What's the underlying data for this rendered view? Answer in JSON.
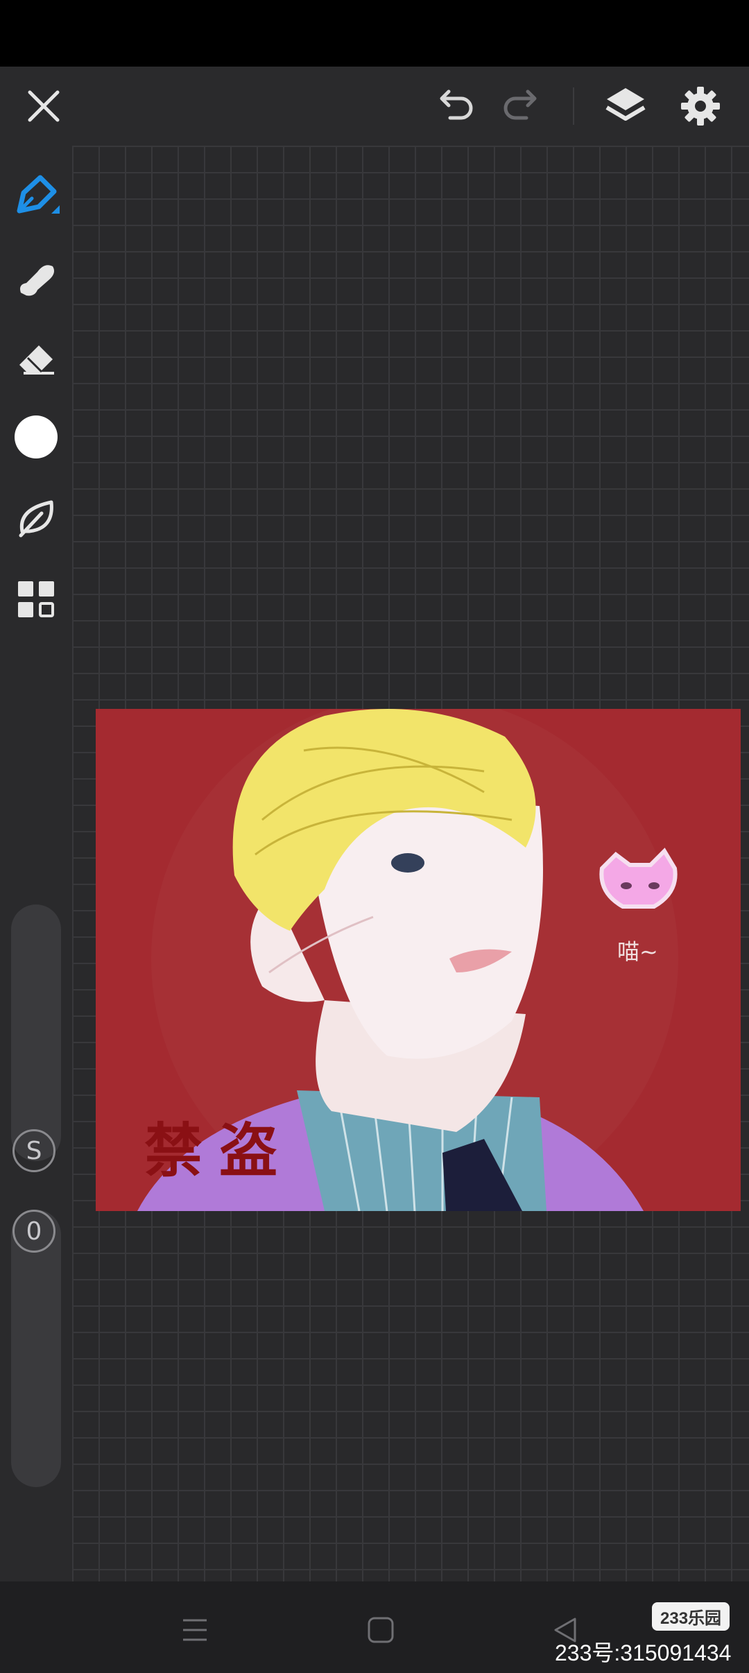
{
  "topbar": {
    "close_icon": "close-icon",
    "undo_icon": "undo-icon",
    "redo_icon": "redo-icon",
    "layers_icon": "layers-icon",
    "settings_icon": "gear-icon"
  },
  "tools": [
    {
      "name": "pen",
      "icon": "pen-icon",
      "selected": true
    },
    {
      "name": "smudge",
      "icon": "smudge-icon"
    },
    {
      "name": "eraser",
      "icon": "eraser-icon"
    },
    {
      "name": "color",
      "icon": "color-swatch-icon",
      "color": "#ffffff"
    },
    {
      "name": "blend",
      "icon": "leaf-icon"
    },
    {
      "name": "more",
      "icon": "grid-icon"
    }
  ],
  "side_controls": {
    "size_label": "S",
    "opacity_label": "0"
  },
  "artwork": {
    "watermark": "禁盗",
    "signature": "喵~"
  },
  "colors": {
    "accent": "#1e8fe6",
    "background": "#29292b",
    "artwork_bg": "#a42a30"
  },
  "overlay": {
    "badge": "233乐园",
    "id_text": "233号:315091434"
  }
}
